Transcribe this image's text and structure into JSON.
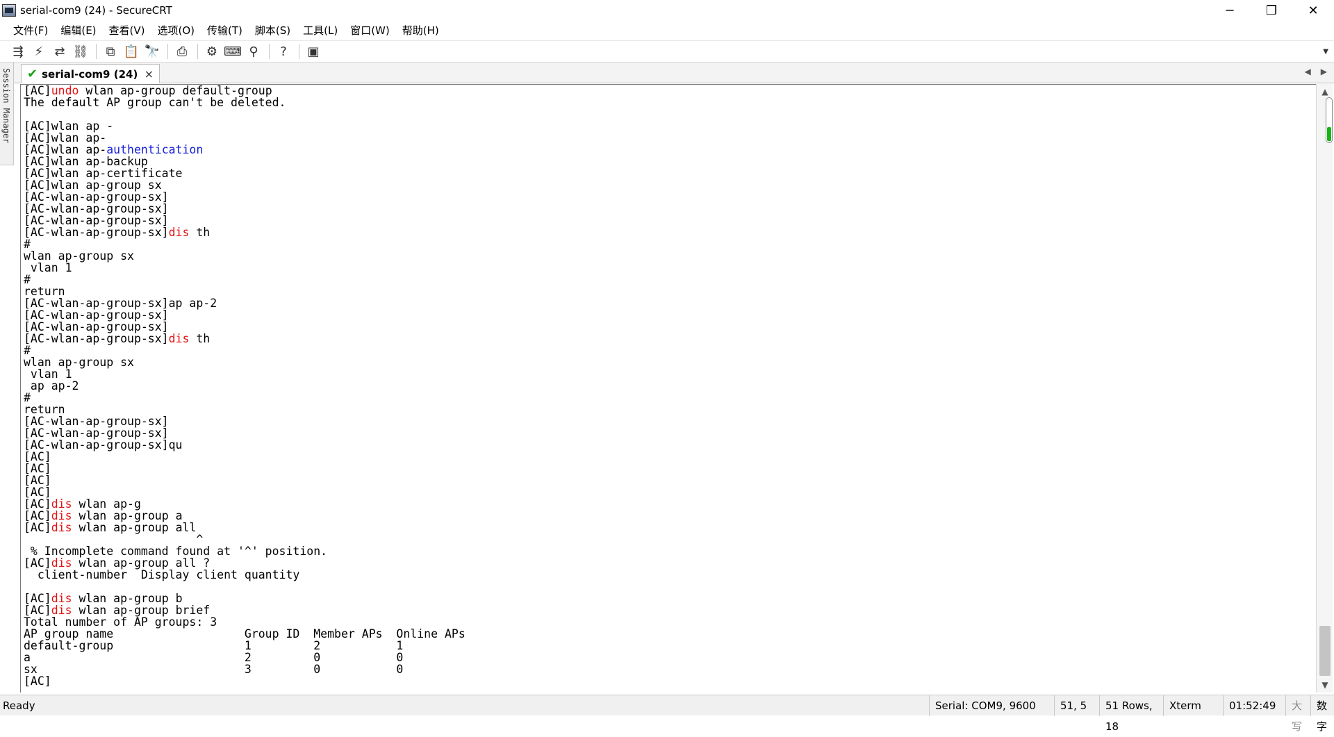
{
  "window": {
    "title": "serial-com9 (24) - SecureCRT",
    "minimize": "─",
    "restore": "❐",
    "close": "✕"
  },
  "menu": [
    "文件(F)",
    "编辑(E)",
    "查看(V)",
    "选项(O)",
    "传输(T)",
    "脚本(S)",
    "工具(L)",
    "窗口(W)",
    "帮助(H)"
  ],
  "toolbar": {
    "icons": [
      "connect-bar-icon",
      "quick-connect-icon",
      "reconnect-icon",
      "disconnect-icon",
      "copy-icon",
      "paste-icon",
      "find-icon",
      "print-icon",
      "settings-icon",
      "keymap-icon",
      "sftp-icon",
      "help-icon",
      "screen-icon"
    ]
  },
  "session_manager": {
    "label": "Session Manager"
  },
  "tab": {
    "label": "serial-com9 (24)",
    "close": "×",
    "left": "◀",
    "right": "▶"
  },
  "terminal": {
    "lines": [
      [
        {
          "t": "[AC]"
        },
        {
          "t": "undo",
          "c": "red"
        },
        {
          "t": " wlan ap-group default-group"
        }
      ],
      [
        {
          "t": "The default AP group can't be deleted."
        }
      ],
      [
        {
          "t": ""
        }
      ],
      [
        {
          "t": "[AC]wlan ap -"
        }
      ],
      [
        {
          "t": "[AC]wlan ap-"
        }
      ],
      [
        {
          "t": "[AC]wlan ap-"
        },
        {
          "t": "authentication",
          "c": "blue"
        }
      ],
      [
        {
          "t": "[AC]wlan ap-backup"
        }
      ],
      [
        {
          "t": "[AC]wlan ap-certificate"
        }
      ],
      [
        {
          "t": "[AC]wlan ap-group sx"
        }
      ],
      [
        {
          "t": "[AC-wlan-ap-group-sx]"
        }
      ],
      [
        {
          "t": "[AC-wlan-ap-group-sx]"
        }
      ],
      [
        {
          "t": "[AC-wlan-ap-group-sx]"
        }
      ],
      [
        {
          "t": "[AC-wlan-ap-group-sx]"
        },
        {
          "t": "dis",
          "c": "red"
        },
        {
          "t": " th"
        }
      ],
      [
        {
          "t": "#"
        }
      ],
      [
        {
          "t": "wlan ap-group sx"
        }
      ],
      [
        {
          "t": " vlan 1"
        }
      ],
      [
        {
          "t": "#"
        }
      ],
      [
        {
          "t": "return"
        }
      ],
      [
        {
          "t": "[AC-wlan-ap-group-sx]ap ap-2"
        }
      ],
      [
        {
          "t": "[AC-wlan-ap-group-sx]"
        }
      ],
      [
        {
          "t": "[AC-wlan-ap-group-sx]"
        }
      ],
      [
        {
          "t": "[AC-wlan-ap-group-sx]"
        },
        {
          "t": "dis",
          "c": "red"
        },
        {
          "t": " th"
        }
      ],
      [
        {
          "t": "#"
        }
      ],
      [
        {
          "t": "wlan ap-group sx"
        }
      ],
      [
        {
          "t": " vlan 1"
        }
      ],
      [
        {
          "t": " ap ap-2"
        }
      ],
      [
        {
          "t": "#"
        }
      ],
      [
        {
          "t": "return"
        }
      ],
      [
        {
          "t": "[AC-wlan-ap-group-sx]"
        }
      ],
      [
        {
          "t": "[AC-wlan-ap-group-sx]"
        }
      ],
      [
        {
          "t": "[AC-wlan-ap-group-sx]qu"
        }
      ],
      [
        {
          "t": "[AC]"
        }
      ],
      [
        {
          "t": "[AC]"
        }
      ],
      [
        {
          "t": "[AC]"
        }
      ],
      [
        {
          "t": "[AC]"
        }
      ],
      [
        {
          "t": "[AC]"
        },
        {
          "t": "dis",
          "c": "red"
        },
        {
          "t": " wlan ap-g"
        }
      ],
      [
        {
          "t": "[AC]"
        },
        {
          "t": "dis",
          "c": "red"
        },
        {
          "t": " wlan ap-group a"
        }
      ],
      [
        {
          "t": "[AC]"
        },
        {
          "t": "dis",
          "c": "red"
        },
        {
          "t": " wlan ap-group all"
        }
      ],
      [
        {
          "t": "                         ^"
        }
      ],
      [
        {
          "t": " % Incomplete command found at '^' position."
        }
      ],
      [
        {
          "t": "[AC]"
        },
        {
          "t": "dis",
          "c": "red"
        },
        {
          "t": " wlan ap-group all ?"
        }
      ],
      [
        {
          "t": "  client-number  Display client quantity"
        }
      ],
      [
        {
          "t": ""
        }
      ],
      [
        {
          "t": "[AC]"
        },
        {
          "t": "dis",
          "c": "red"
        },
        {
          "t": " wlan ap-group b"
        }
      ],
      [
        {
          "t": "[AC]"
        },
        {
          "t": "dis",
          "c": "red"
        },
        {
          "t": " wlan ap-group brief"
        }
      ],
      [
        {
          "t": "Total number of AP groups: 3"
        }
      ],
      [
        {
          "t": "AP group name                   Group ID  Member APs  Online APs"
        }
      ],
      [
        {
          "t": "default-group                   1         2           1"
        }
      ],
      [
        {
          "t": "a                               2         0           0"
        }
      ],
      [
        {
          "t": "sx                              3         0           0"
        }
      ],
      [
        {
          "t": "[AC]"
        }
      ]
    ]
  },
  "colors": {
    "keyword_red": "#e31313",
    "keyword_blue": "#1520d8",
    "check_green": "#1aa31a"
  },
  "status": {
    "ready": "Ready",
    "serial": "Serial: COM9, 9600",
    "position": "51,  5",
    "size": "51 Rows, 18",
    "term_type": "Xterm",
    "time": "01:52:49",
    "caps": "大写",
    "num": "数字"
  }
}
